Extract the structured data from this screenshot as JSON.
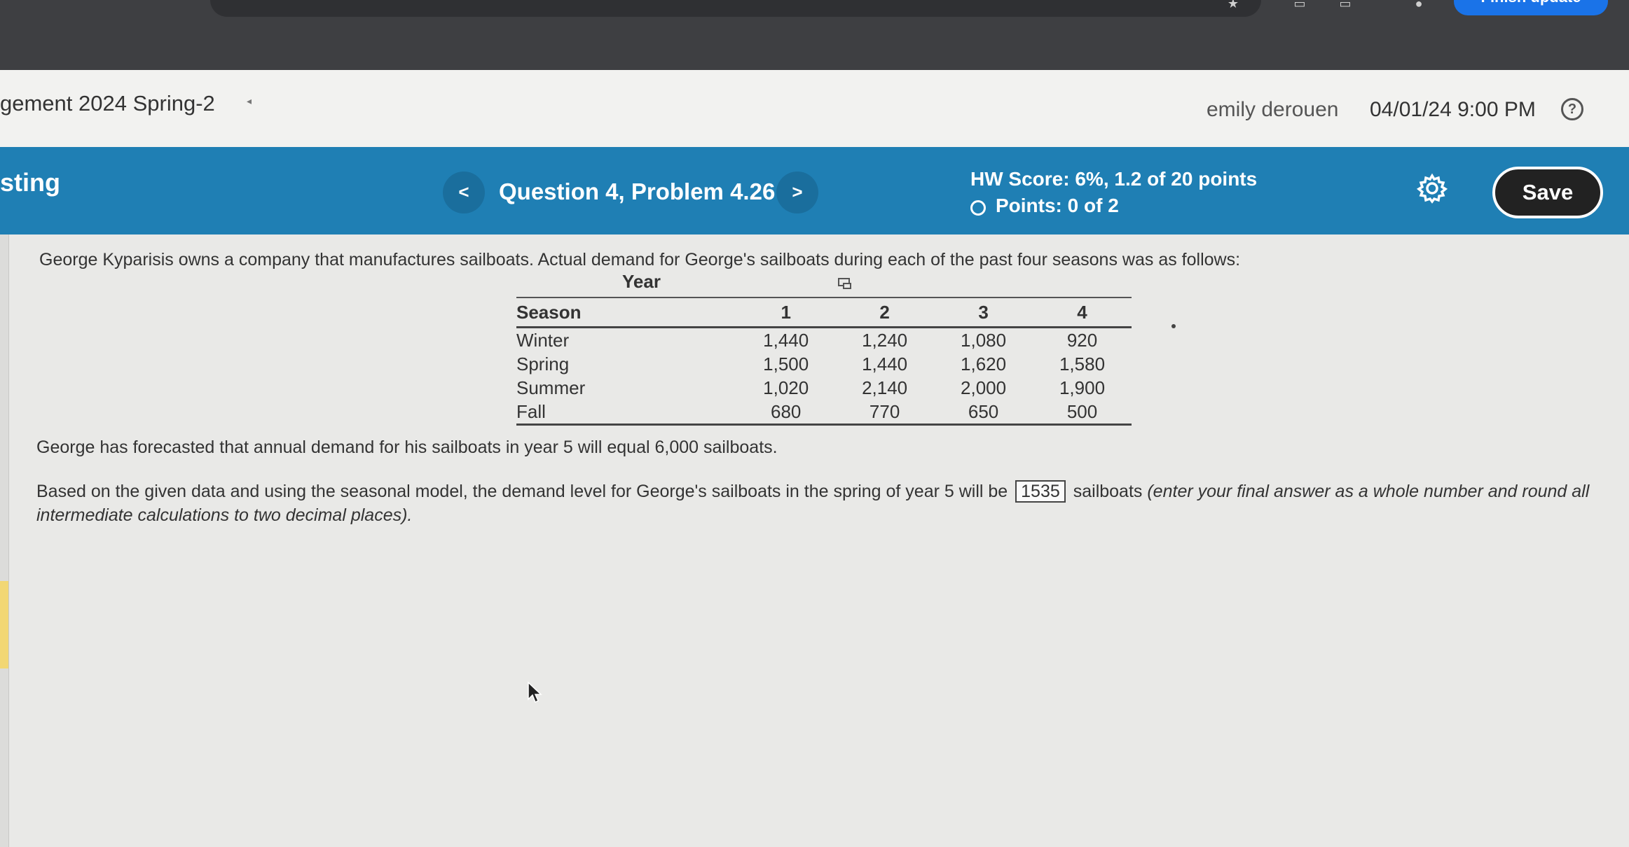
{
  "browser": {
    "finish_update_label": "Finish update"
  },
  "header": {
    "course_title": "gement 2024 Spring-2",
    "user_name": "emily derouen",
    "due_date": "04/01/24 9:00 PM",
    "help_label": "?"
  },
  "question_bar": {
    "section_label": "sting",
    "prev_label": "<",
    "next_label": ">",
    "question_title": "Question 4, Problem 4.26",
    "hw_score": "HW Score: 6%, 1.2 of 20 points",
    "points": "Points: 0 of 2",
    "save_label": "Save"
  },
  "problem": {
    "intro": "George Kyparisis owns a company that manufactures sailboats. Actual demand for George's sailboats during each of the past four seasons was as follows:",
    "year_header": "Year",
    "table": {
      "columns": [
        "Season",
        "1",
        "2",
        "3",
        "4"
      ],
      "rows": [
        [
          "Winter",
          "1,440",
          "1,240",
          "1,080",
          "920"
        ],
        [
          "Spring",
          "1,500",
          "1,440",
          "1,620",
          "1,580"
        ],
        [
          "Summer",
          "1,020",
          "2,140",
          "2,000",
          "1,900"
        ],
        [
          "Fall",
          "680",
          "770",
          "650",
          "500"
        ]
      ]
    },
    "forecast": "George has forecasted that annual demand for his sailboats in year 5 will equal 6,000 sailboats.",
    "question_prefix": "Based on the given data and using the seasonal model, the demand level for George's sailboats in the spring of year 5 will be",
    "answer_value": "1535",
    "question_unit": "sailboats",
    "question_instruction": "(enter your final answer as a whole number and round all intermediate calculations to two decimal places)."
  },
  "colors": {
    "question_bar": "#1f7fb4",
    "save_button": "#222222",
    "finish_update": "#1a73e8"
  }
}
